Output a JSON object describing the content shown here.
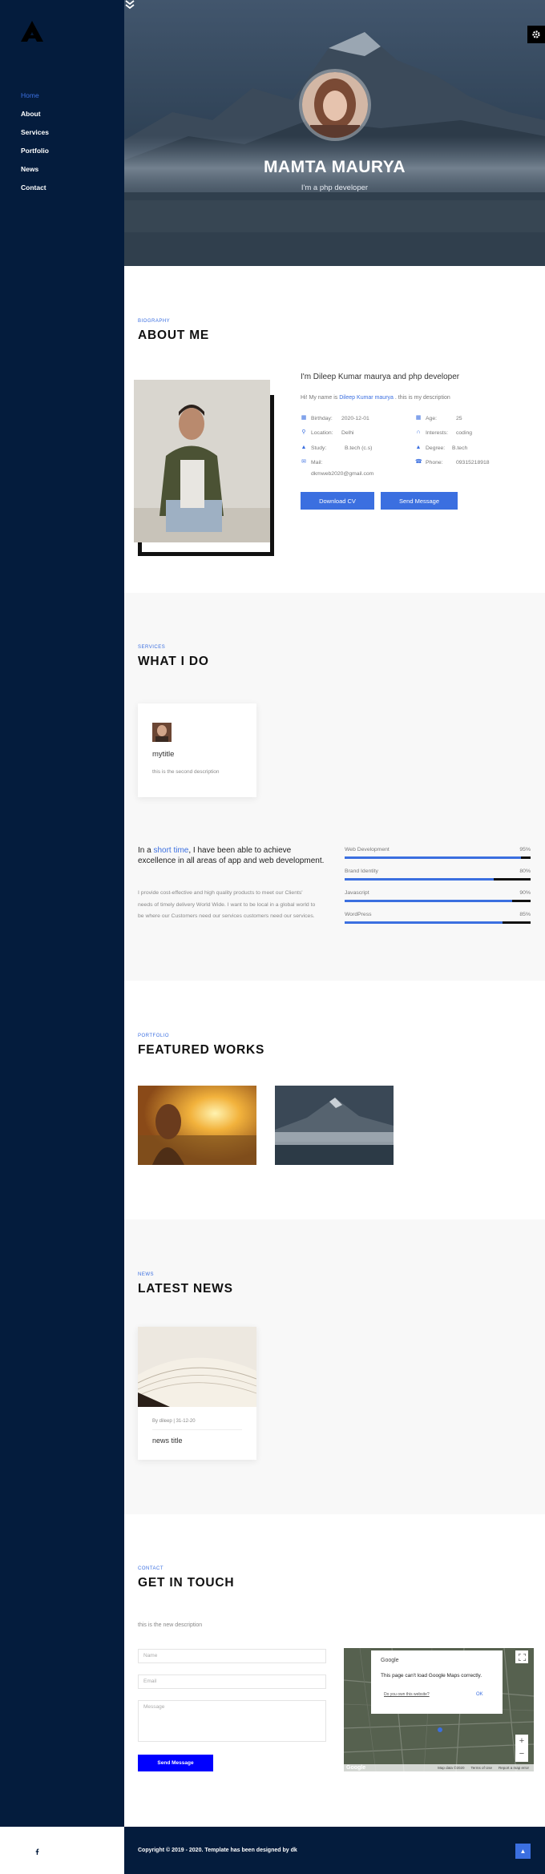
{
  "nav": {
    "items": [
      "Home",
      "About",
      "Services",
      "Portfolio",
      "News",
      "Contact"
    ],
    "active": "Home"
  },
  "hero": {
    "name": "MAMTA MAURYA",
    "subtitle": "I'm a php developer"
  },
  "about": {
    "tag": "BIOGRAPHY",
    "title": "ABOUT ME",
    "heading": "I'm Dileep Kumar maurya and php developer",
    "desc_prefix": "Hi! My name is ",
    "desc_link": "Dileep Kumar maurya",
    "desc_suffix": " . this is my description",
    "info": [
      {
        "key": "Birthday:",
        "value": "2020-12-01",
        "icon": "calendar-icon"
      },
      {
        "key": "Age:",
        "value": "25",
        "icon": "calendar-icon"
      },
      {
        "key": "Location:",
        "value": "Delhi",
        "icon": "map-pin-icon"
      },
      {
        "key": "Interests:",
        "value": "coding",
        "icon": "headphones-icon"
      },
      {
        "key": "Study:",
        "value": "B.tech (c.s)",
        "icon": "graduation-cap-icon"
      },
      {
        "key": "Degree:",
        "value": "B.tech",
        "icon": "graduation-cap-icon"
      },
      {
        "key": "Mail:",
        "value": "dkmweb2020@gmail.com",
        "icon": "mail-icon"
      },
      {
        "key": "Phone:",
        "value": "09315218918",
        "icon": "phone-icon"
      }
    ],
    "download_label": "Download CV",
    "message_label": "Send Message"
  },
  "services": {
    "tag": "SERVICES",
    "title": "WHAT I DO",
    "card": {
      "title": "mytitle",
      "desc": "this is the second description"
    },
    "lead_prefix": "In a ",
    "lead_highlight": "short time",
    "lead_suffix": ", I have been able to achieve excellence in all areas of app and web development.",
    "paragraph": "I provide cost-effective and high quality products to meet our Clients' needs of timely delivery World Wide. I want to be local in a global world to be where our Customers need our services customers need our services.",
    "skills": [
      {
        "name": "Web Development",
        "percent_label": "95%",
        "value": 95
      },
      {
        "name": "Brand Identity",
        "percent_label": "80%",
        "value": 80
      },
      {
        "name": "Javascript",
        "percent_label": "90%",
        "value": 90
      },
      {
        "name": "WordPress",
        "percent_label": "85%",
        "value": 85
      }
    ]
  },
  "portfolio": {
    "tag": "PORTFOLIO",
    "title": "FEATURED WORKS"
  },
  "news": {
    "tag": "NEWS",
    "title": "LATEST NEWS",
    "card": {
      "meta": "By dileep  |  31-12-20",
      "title": "news title"
    }
  },
  "contact": {
    "tag": "CONTACT",
    "title": "GET IN TOUCH",
    "desc": "this is the new description",
    "name_placeholder": "Name",
    "email_placeholder": "Email",
    "message_placeholder": "Message",
    "send_label": "Send Message",
    "map": {
      "brand": "Google",
      "message": "This page can't load Google Maps correctly.",
      "own_link": "Do you own this website?",
      "ok_label": "OK",
      "footer_items": [
        "Map data ©2020",
        "Terms of Use",
        "Report a map error"
      ],
      "watermark": "Google"
    }
  },
  "footer": {
    "copyright": "Copyright © 2019 - 2020. Template has been designed by dk"
  },
  "colors": {
    "accent": "#3b6fe0",
    "sidebar": "#041c3d",
    "send_button": "#0000ff"
  }
}
